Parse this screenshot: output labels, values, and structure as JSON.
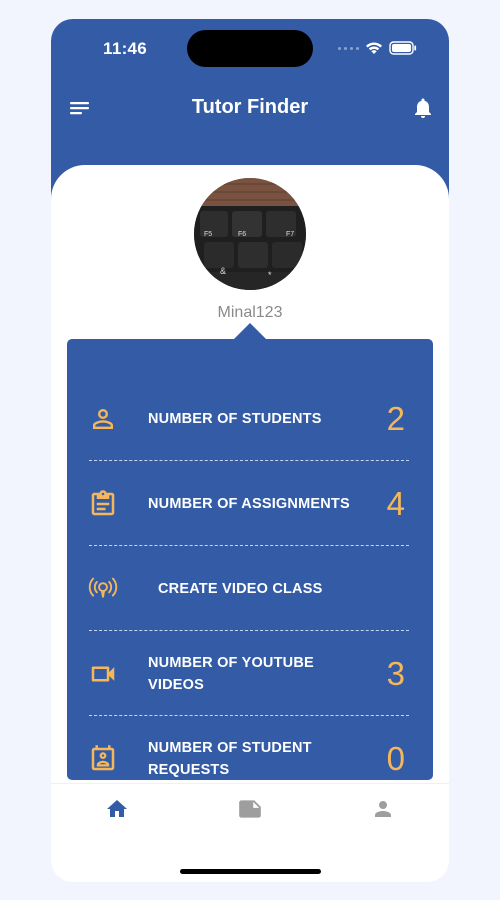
{
  "status_bar": {
    "time": "11:46"
  },
  "app_bar": {
    "title": "Tutor Finder"
  },
  "profile": {
    "username": "Minal123"
  },
  "stats": [
    {
      "icon": "person-icon",
      "label": "NUMBER OF STUDENTS",
      "count": "2"
    },
    {
      "icon": "assignment-icon",
      "label": "NUMBER OF ASSIGNMENTS",
      "count": "4"
    },
    {
      "icon": "broadcast-icon",
      "label": "CREATE VIDEO CLASS",
      "count": ""
    },
    {
      "icon": "video-camera-icon",
      "label": "NUMBER OF YOUTUBE VIDEOS",
      "count": "3"
    },
    {
      "icon": "contact-badge-icon",
      "label": "NUMBER OF STUDENT REQUESTS",
      "count": "0"
    }
  ],
  "bottom_nav": [
    {
      "icon": "home-icon",
      "active": true
    },
    {
      "icon": "note-icon",
      "active": false
    },
    {
      "icon": "profile-icon",
      "active": false
    }
  ],
  "colors": {
    "primary": "#345ca6",
    "accent": "#f5b75a",
    "nav_active": "#345ca6",
    "nav_inactive": "#9e9e9e"
  }
}
